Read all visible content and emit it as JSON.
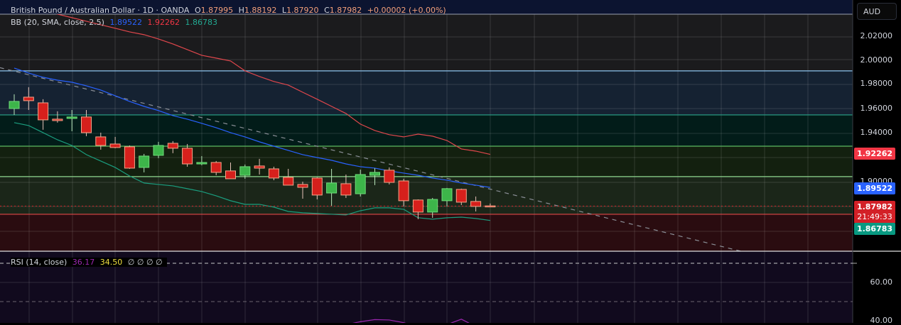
{
  "header": {
    "symbol": "British Pound / Australian Dollar · 1D · OANDA",
    "o_label": "O",
    "o_value": "1.87995",
    "h_label": "H",
    "h_value": "1.88192",
    "l_label": "L",
    "l_value": "1.87920",
    "c_label": "C",
    "c_value": "1.87982",
    "change": "+0.00002 (+0.00%)"
  },
  "bb_legend": {
    "label": "BB (20, SMA, close, 2.5)",
    "basis": "1.89522",
    "upper": "1.92262",
    "lower": "1.86783"
  },
  "rsi_legend": {
    "label": "RSI (14, close)",
    "rsi": "36.17",
    "ma": "34.50",
    "extras": "∅ ∅ ∅ ∅"
  },
  "price_axis": {
    "currency_button": "AUD",
    "ticks": [
      "2.02000",
      "2.00000",
      "1.98000",
      "1.96000",
      "1.94000",
      "1.90000"
    ],
    "upper_tag": "1.92262",
    "basis_tag": "1.89522",
    "last_price_tag": "1.87982",
    "countdown": "21:49:33",
    "lower_tag": "1.86783"
  },
  "rsi_axis": {
    "ticks": [
      "60.00",
      "40.00"
    ]
  },
  "colors": {
    "up": "#3db54a",
    "down": "#d6201c",
    "down_border": "#f5a58a",
    "bb_upper": "#e0474c",
    "bb_basis": "#2962ff",
    "bb_lower": "#1b9e7f",
    "rsi": "#9c27b0",
    "ma": "#f0e040"
  },
  "chart_data": {
    "type": "candlestick",
    "title": "British Pound / Australian Dollar · 1D · OANDA",
    "ylim": [
      1.84,
      2.04
    ],
    "candles": [
      [
        1.9606,
        1.9724,
        1.9553,
        1.9665
      ],
      [
        1.97,
        1.9783,
        1.9594,
        1.9671
      ],
      [
        1.9653,
        1.9683,
        1.943,
        1.9512
      ],
      [
        1.9518,
        1.9583,
        1.9489,
        1.9506
      ],
      [
        1.9524,
        1.9594,
        1.9418,
        1.9536
      ],
      [
        1.9536,
        1.9594,
        1.9377,
        1.9406
      ],
      [
        1.9371,
        1.9406,
        1.9265,
        1.93
      ],
      [
        1.9312,
        1.9371,
        1.9277,
        1.9283
      ],
      [
        1.9289,
        1.93,
        1.9106,
        1.9112
      ],
      [
        1.9118,
        1.923,
        1.9077,
        1.9212
      ],
      [
        1.9218,
        1.933,
        1.9195,
        1.93
      ],
      [
        1.9318,
        1.9336,
        1.9236,
        1.9277
      ],
      [
        1.9277,
        1.9312,
        1.9124,
        1.9147
      ],
      [
        1.9147,
        1.9212,
        1.9136,
        1.9159
      ],
      [
        1.9159,
        1.9171,
        1.9053,
        1.9077
      ],
      [
        1.9089,
        1.9159,
        1.9024,
        1.9024
      ],
      [
        1.9053,
        1.9142,
        1.9024,
        1.9124
      ],
      [
        1.913,
        1.9189,
        1.9059,
        1.9112
      ],
      [
        1.9106,
        1.9124,
        1.9012,
        1.903
      ],
      [
        1.9036,
        1.9106,
        1.8971,
        1.8971
      ],
      [
        1.8977,
        1.9,
        1.8859,
        1.8953
      ],
      [
        1.903,
        1.9036,
        1.8853,
        1.8889
      ],
      [
        1.8906,
        1.9106,
        1.88,
        1.8989
      ],
      [
        1.8983,
        1.9059,
        1.8865,
        1.8889
      ],
      [
        1.89,
        1.91,
        1.8877,
        1.9059
      ],
      [
        1.9053,
        1.9112,
        1.8971,
        1.9077
      ],
      [
        1.9095,
        1.9118,
        1.8977,
        1.8994
      ],
      [
        1.9006,
        1.9024,
        1.8795,
        1.8842
      ],
      [
        1.8848,
        1.8853,
        1.8689,
        1.8748
      ],
      [
        1.8748,
        1.8865,
        1.87,
        1.8853
      ],
      [
        1.8842,
        1.8948,
        1.8795,
        1.8942
      ],
      [
        1.8936,
        1.8942,
        1.8806,
        1.883
      ],
      [
        1.8836,
        1.8877,
        1.8753,
        1.8795
      ],
      [
        1.87995,
        1.88192,
        1.8792,
        1.87982
      ]
    ],
    "bb_upper": [
      2.0476,
      2.0447,
      2.0418,
      2.0388,
      2.0359,
      2.0329,
      2.03,
      2.0271,
      2.0241,
      2.0218,
      2.0182,
      2.0141,
      2.0094,
      2.0047,
      2.0024,
      2.0,
      1.9918,
      1.9871,
      1.983,
      1.98,
      1.9741,
      1.9683,
      1.9624,
      1.9565,
      1.9477,
      1.9424,
      1.9389,
      1.9371,
      1.9394,
      1.9377,
      1.9341,
      1.9271,
      1.9253,
      1.92262
    ],
    "bb_basis": [
      1.9941,
      1.99,
      1.9865,
      1.9841,
      1.9824,
      1.9794,
      1.9759,
      1.9712,
      1.9665,
      1.9624,
      1.9589,
      1.9547,
      1.9518,
      1.9483,
      1.9447,
      1.9406,
      1.9371,
      1.933,
      1.9294,
      1.9259,
      1.9224,
      1.92,
      1.9177,
      1.9147,
      1.9124,
      1.9112,
      1.9089,
      1.9071,
      1.9053,
      1.903,
      1.9012,
      1.8989,
      1.8971,
      1.89522
    ],
    "bb_lower": [
      1.9489,
      1.9465,
      1.9406,
      1.9347,
      1.93,
      1.9224,
      1.9171,
      1.9118,
      1.9047,
      1.8989,
      1.8977,
      1.8965,
      1.8942,
      1.8918,
      1.8883,
      1.8842,
      1.8812,
      1.8812,
      1.8789,
      1.8753,
      1.8742,
      1.8736,
      1.873,
      1.8724,
      1.8759,
      1.8783,
      1.8783,
      1.8771,
      1.8701,
      1.8689,
      1.8701,
      1.8706,
      1.8695,
      1.86783
    ],
    "levels": [
      {
        "price": 1.9918,
        "color": "#8cc4f0",
        "fill_below": "#152232"
      },
      {
        "price": 1.9553,
        "color": "#2aa58a",
        "fill_below": "#021c19"
      },
      {
        "price": 1.9294,
        "color": "#5cb860",
        "fill_below": "#13200f"
      },
      {
        "price": 1.9042,
        "color": "#8fd88f",
        "fill_below": "#1b2619"
      },
      {
        "price": 1.873,
        "color": "#e04848",
        "fill_below": "#2a0c10"
      }
    ],
    "trendline": {
      "from_index": -1,
      "from_price": 1.9945,
      "to_index": 50.5,
      "to_price": 1.842
    },
    "rsi": {
      "start_index": 23,
      "values": [
        38.0,
        39.5,
        40.6,
        40.4,
        39.0,
        37.0,
        36.0,
        38.0,
        40.8,
        37.0,
        36.17
      ],
      "levels": [
        70,
        50
      ],
      "ylim": [
        38.5,
        75
      ]
    }
  }
}
